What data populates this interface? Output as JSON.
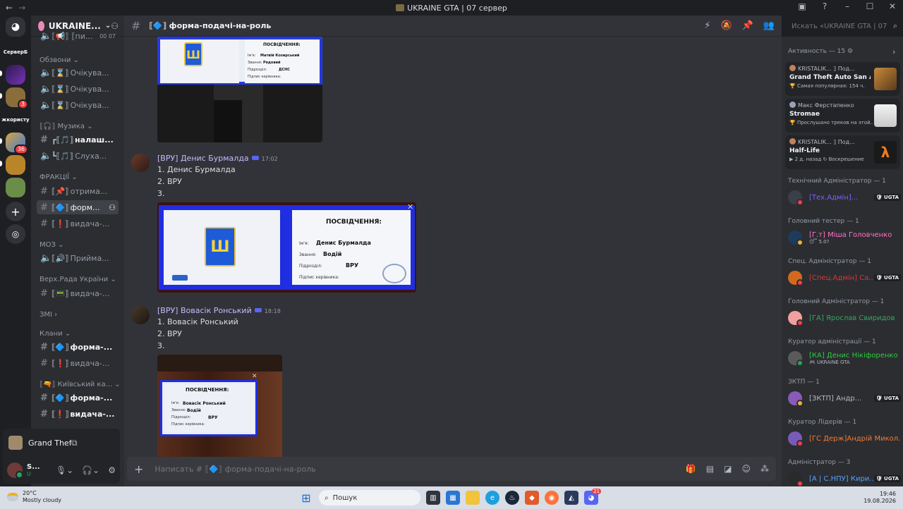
{
  "window": {
    "title": "UKRAINE GTA | 07 сервер",
    "back": "←",
    "forward": "→"
  },
  "rail": {
    "server_label_1": "СерверБ",
    "server_label_2": "жкористу",
    "badge_1": "3",
    "badge_2": "36"
  },
  "guild": {
    "name": "UKRAINE..."
  },
  "channels": {
    "top_partial": "⟦📢⟧ ⟦пи...",
    "top_partial_counts": "00 07",
    "cat_obzvony": "Обзвони",
    "ch_wait_1": "Очікува...",
    "ch_wait_2": "Очікува...",
    "ch_wait_3": "Очікува...",
    "cat_music": "⟦🎧⟧ Музика",
    "ch_settings": "налаш...",
    "ch_listen": "Слуха...",
    "cat_factions": "ФРАКЦІЇ",
    "ch_receive": "отрима...",
    "ch_form_selected": "форм...",
    "ch_issue_1": "видача-...",
    "cat_moz": "МОЗ",
    "ch_accept": "Прийма...",
    "cat_verkhrada": "Верх.Рада України",
    "ch_issue_2": "видача-...",
    "cat_zmi": "ЗМІ",
    "cat_clans": "Клани",
    "ch_form_2": "форма-...",
    "ch_issue_3": "видача-...",
    "cat_kyiv": "⟦🔫⟧ Київський ка...",
    "ch_form_3": "форма-...",
    "ch_issue_4": "видача-..."
  },
  "activity": {
    "game": "Grand Theft Auto S..."
  },
  "user": {
    "name": "S...",
    "status": "U"
  },
  "header": {
    "channel_name": "⟦🔷⟧ форма-подачі-на-роль",
    "search_placeholder": "Искать «UKRAINE GTA | 07 серв..."
  },
  "messages": {
    "card_1": {
      "title": "ПОСВІДЧЕННЯ:",
      "label_name": "Ім'я:",
      "value_name": "Матвій Козирський",
      "label_rank": "Звання:",
      "value_rank": "Рядовий",
      "label_unit": "Підрозділ:",
      "value_unit": "ДСНС",
      "label_sign": "Підпис керівника:"
    },
    "m1": {
      "author": "[ВРУ] Денис Бурмалда",
      "time": "17:02",
      "line1": "1. Денис Бурмалда",
      "line2": "2. ВРУ",
      "line3": "3.",
      "card": {
        "title": "ПОСВІДЧЕННЯ:",
        "label_name": "Ім'я:",
        "value_name": "Денис Бурмалда",
        "label_rank": "Звання:",
        "value_rank": "Водій",
        "label_unit": "Підрозділ:",
        "value_unit": "ВРУ",
        "label_sign": "Підпис керівника:",
        "close": "✕"
      }
    },
    "m2": {
      "author": "[ВРУ] Вовасік Ронський",
      "time": "18:18",
      "line1": "1. Вовасік Ронський",
      "line2": "2. ВРУ",
      "line3": "3.",
      "card": {
        "title": "ПОСВІДЧЕННЯ:",
        "label_name": "Ім'я:",
        "value_name": "Вовасік Ронський",
        "label_rank": "Звання:",
        "value_rank": "Водій",
        "label_unit": "Підрозділ:",
        "value_unit": "ВРУ",
        "label_sign": "Підпис керівника:",
        "close": "✕"
      }
    }
  },
  "composer": {
    "placeholder": "Написать # ⟦🔷⟧ форма-подачі-на-роль"
  },
  "members": {
    "activity_header": "Активность — 15",
    "activities": [
      {
        "who": "KRISTALIK... ⟧ Под...",
        "game": "Grand Theft Auto San Andr...",
        "sub": "🏆 Самая популярная: 154 ч."
      },
      {
        "who": "Макс Ферстапенко",
        "game": "Stromae",
        "sub": "🏆 Прослушано треков на этой..."
      },
      {
        "who": "KRISTALIK... ⟧ Под...",
        "game": "Half-Life",
        "sub": "▶ 2 д. назад  ↻ Воскрешение"
      }
    ],
    "groups": [
      {
        "title": "Технічний Адміністратор — 1",
        "name": "[Тех.Адмін]...",
        "color": "#7b61ff",
        "ugta": "UGTA",
        "status": ""
      },
      {
        "title": "Головний тестер — 1",
        "name": "[Г.т] Міша Головченко",
        "color": "#ff73c7",
        "ugta": "",
        "status": "😴 5.0?"
      },
      {
        "title": "Спец. Адміністратор — 1",
        "name": "[Спец.Адмін] Са...",
        "color": "#d63a3a",
        "ugta": "UGTA",
        "status": ""
      },
      {
        "title": "Головний Адміністратор — 1",
        "name": "[ГА] Ярослав Свиридов",
        "color": "#3ba55d",
        "ugta": "",
        "status": ""
      },
      {
        "title": "Куратор адміністрації — 1",
        "name": "[КА] Денис Нікіфоренко",
        "color": "#2ecc40",
        "ugta": "",
        "status": "🎮 UKRAINE GTA"
      },
      {
        "title": "ЗКТП — 1",
        "name": "[ЗКТП] Андр...",
        "color": "#b5bac1",
        "ugta": "UGTA",
        "status": ""
      },
      {
        "title": "Куратор Лідерів — 1",
        "name": "[ГС Держ]Андрій Микол...",
        "color": "#f47b35",
        "ugta": "",
        "status": ""
      },
      {
        "title": "Адміністратор — 3",
        "name": "[А | С.НПУ] Кири...",
        "color": "#5aa0ff",
        "ugta": "UGTA",
        "status": ""
      }
    ]
  },
  "taskbar": {
    "temp": "20°C",
    "weather": "Mostly cloudy",
    "search": "Пошук",
    "time": "19:46",
    "date": "19.08.2026",
    "discord_badge": "21"
  }
}
